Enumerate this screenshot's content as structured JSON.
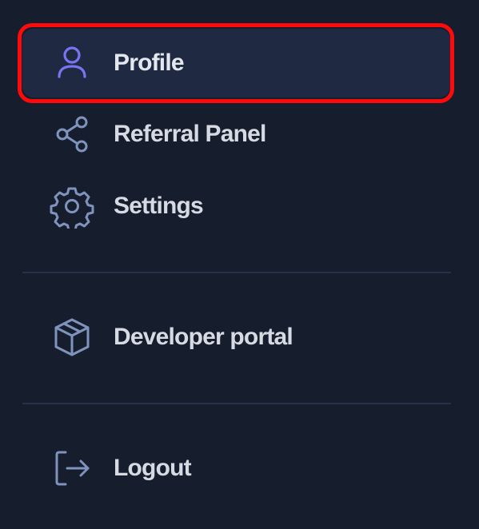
{
  "menu": {
    "items": [
      {
        "label": "Profile",
        "icon": "user-icon",
        "active": true
      },
      {
        "label": "Referral Panel",
        "icon": "share-icon",
        "active": false
      },
      {
        "label": "Settings",
        "icon": "gear-icon",
        "active": false
      },
      {
        "label": "Developer portal",
        "icon": "cube-icon",
        "active": false
      },
      {
        "label": "Logout",
        "icon": "logout-icon",
        "active": false
      }
    ]
  },
  "colors": {
    "background": "#161e2e",
    "active_background": "#1f2a42",
    "active_icon": "#7b73f0",
    "inactive_icon": "#7f93bd",
    "label_text": "#d6dae2",
    "highlight_ring": "#ff0a0a",
    "divider": "#27324a"
  }
}
